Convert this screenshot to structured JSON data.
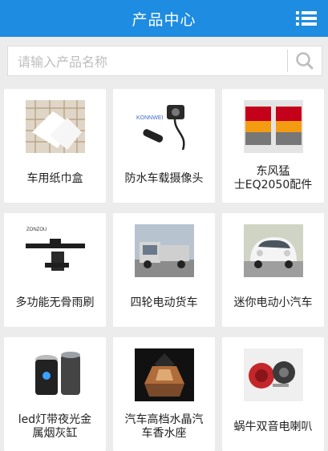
{
  "header": {
    "title": "产品中心",
    "menu_icon": "list-menu-icon"
  },
  "search": {
    "placeholder": "请输入产品名称",
    "icon": "magnifier-icon"
  },
  "products": [
    {
      "label": "车用纸巾盒"
    },
    {
      "label": "防水车载摄像头",
      "image_text": "KONNWEI"
    },
    {
      "label": "东风猛\n士EQ2050配件"
    },
    {
      "label": "多功能无骨雨刷",
      "image_text": "ZONZOU"
    },
    {
      "label": "四轮电动货车"
    },
    {
      "label": "迷你电动小汽车"
    },
    {
      "label": "led灯带夜光金\n属烟灰缸"
    },
    {
      "label": "汽车高档水晶汽\n车香水座"
    },
    {
      "label": "蜗牛双音电喇叭"
    }
  ],
  "colors": {
    "header": "#1e8ce0",
    "background": "#ececec",
    "card": "#ffffff"
  }
}
